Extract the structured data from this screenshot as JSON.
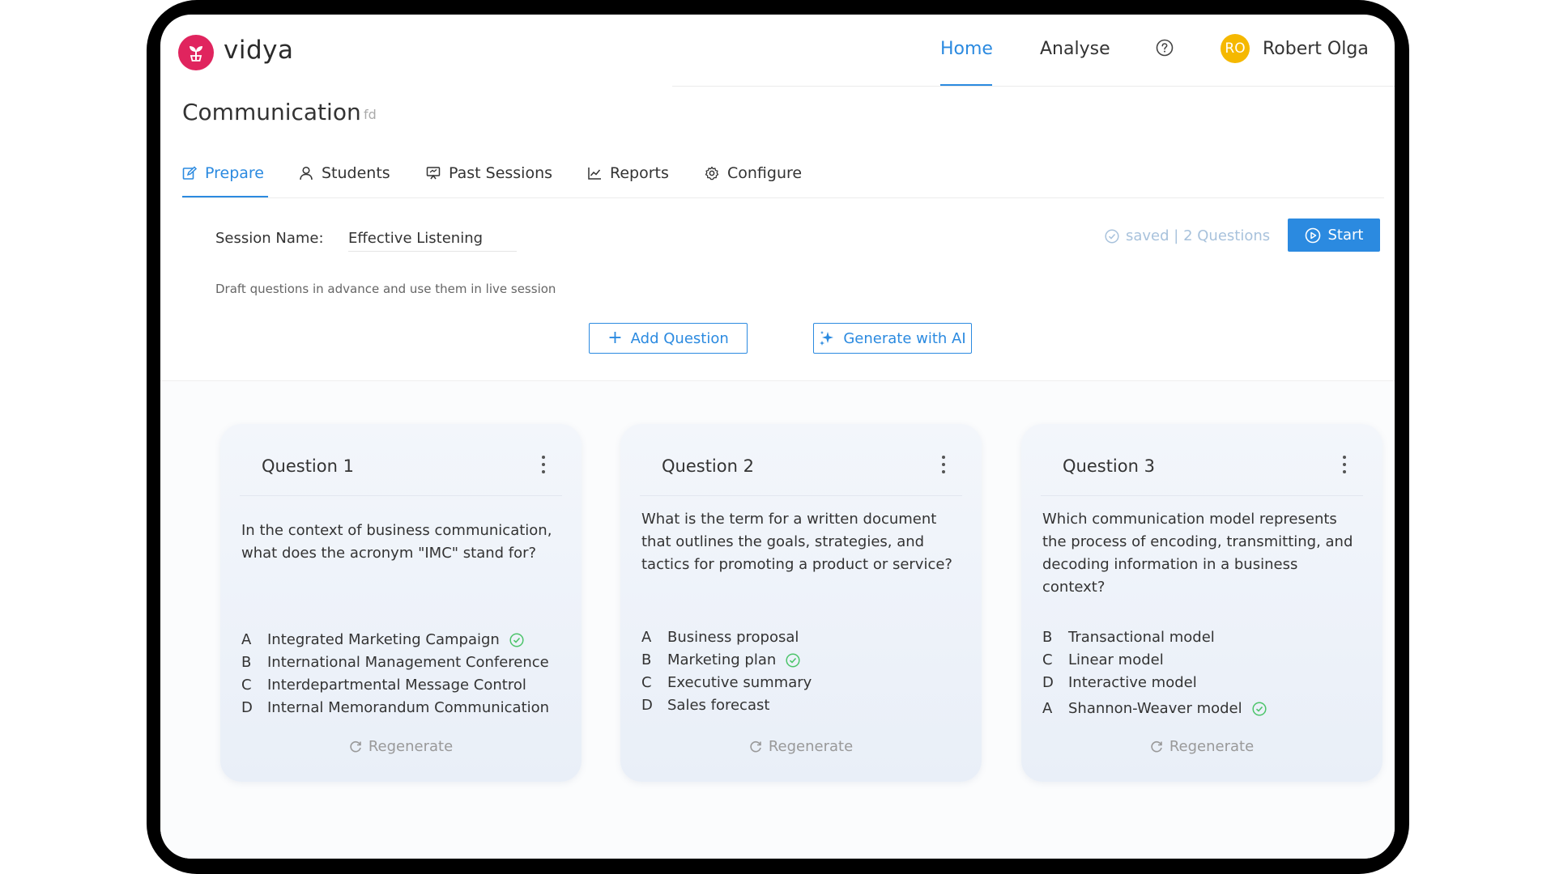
{
  "app": {
    "name": "vidya"
  },
  "nav": {
    "home": "Home",
    "analyse": "Analyse",
    "avatar_initials": "RO",
    "user_name": "Robert Olga"
  },
  "page": {
    "title": "Communication",
    "subtitle": "fd"
  },
  "tabs": [
    {
      "label": "Prepare",
      "icon": "edit-icon",
      "active": true
    },
    {
      "label": "Students",
      "icon": "user-icon"
    },
    {
      "label": "Past Sessions",
      "icon": "presentation-icon"
    },
    {
      "label": "Reports",
      "icon": "line-chart-icon"
    },
    {
      "label": "Configure",
      "icon": "gear-icon"
    }
  ],
  "session": {
    "label": "Session Name:",
    "value": "Effective Listening",
    "status": "saved | 2 Questions",
    "start_label": "Start",
    "helper_text": "Draft questions in advance and use them in live session"
  },
  "actions": {
    "add_question": "Add Question",
    "generate_ai": "Generate with AI"
  },
  "questions": [
    {
      "title": "Question 1",
      "text": "In the context of business communication, what does the acronym \"IMC\" stand for?",
      "options": [
        {
          "letter": "A",
          "text": "Integrated Marketing Campaign",
          "correct": true
        },
        {
          "letter": "B",
          "text": "International Management Conference",
          "correct": false
        },
        {
          "letter": "C",
          "text": "Interdepartmental Message Control",
          "correct": false
        },
        {
          "letter": "D",
          "text": "Internal Memorandum Communication",
          "correct": false
        }
      ],
      "regenerate": "Regenerate"
    },
    {
      "title": "Question 2",
      "text": "What is the term for a written document that outlines the goals, strategies, and tactics for promoting a product or service?",
      "options": [
        {
          "letter": "A",
          "text": "Business proposal",
          "correct": false
        },
        {
          "letter": "B",
          "text": "Marketing plan",
          "correct": true
        },
        {
          "letter": "C",
          "text": "Executive summary",
          "correct": false
        },
        {
          "letter": "D",
          "text": "Sales forecast",
          "correct": false
        }
      ],
      "regenerate": "Regenerate"
    },
    {
      "title": "Question 3",
      "text": "Which communication model represents the process of encoding, transmitting, and decoding information in a business context?",
      "options": [
        {
          "letter": "B",
          "text": "Transactional model",
          "correct": false
        },
        {
          "letter": "C",
          "text": "Linear model",
          "correct": false
        },
        {
          "letter": "D",
          "text": "Interactive model",
          "correct": false
        },
        {
          "letter": "A",
          "text": "Shannon-Weaver model",
          "correct": true
        }
      ],
      "regenerate": "Regenerate"
    }
  ],
  "colors": {
    "accent": "#2b8ae0",
    "brand": "#e0245e",
    "avatar": "#f5b800",
    "correct": "#4cc46a",
    "frame": "#000000"
  }
}
